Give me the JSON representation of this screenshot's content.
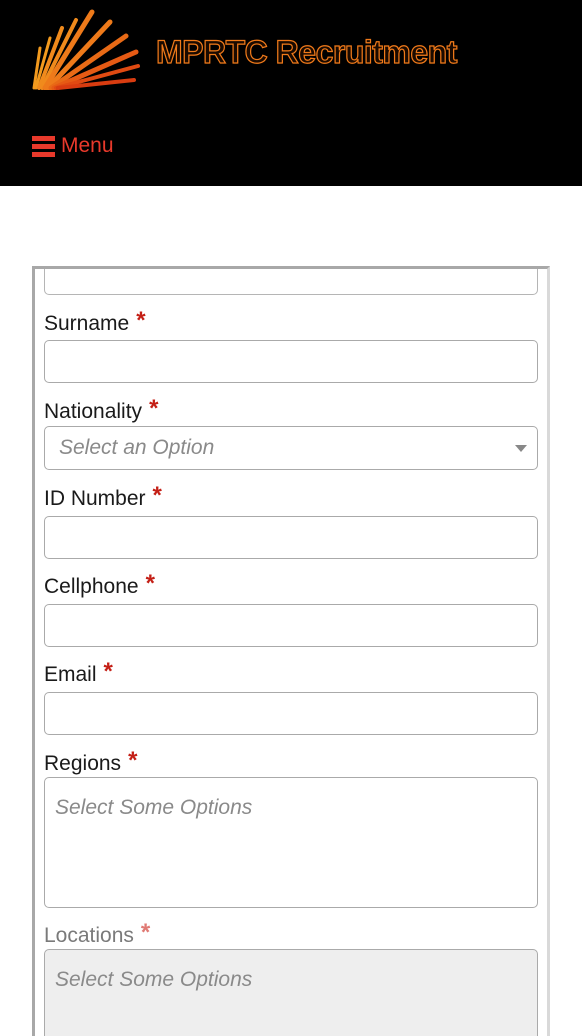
{
  "header": {
    "site_title": "MPRTC Recruitment",
    "logo_icon": "sunburst-logo-icon",
    "menu_icon": "hamburger-icon",
    "menu_label": "Menu",
    "accent_color": "#e8392b",
    "logo_color": "#f07a1a"
  },
  "form": {
    "required_mark": "*",
    "fields": [
      {
        "label": "Surname",
        "type": "text",
        "value": ""
      },
      {
        "label": "Nationality",
        "type": "select",
        "placeholder": "Select an Option"
      },
      {
        "label": "ID Number",
        "type": "text",
        "value": ""
      },
      {
        "label": "Cellphone",
        "type": "text",
        "value": ""
      },
      {
        "label": "Email",
        "type": "text",
        "value": ""
      },
      {
        "label": "Regions",
        "type": "multiselect",
        "placeholder": "Select Some Options"
      },
      {
        "label": "Locations",
        "type": "multiselect",
        "placeholder": "Select Some Options",
        "disabled": true
      }
    ]
  }
}
